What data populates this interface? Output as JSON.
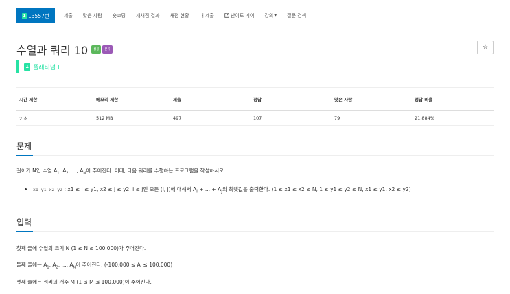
{
  "nav": {
    "problem_number": "13557번",
    "tier_glyph": "1",
    "items": [
      "제출",
      "맞은 사람",
      "숏코딩",
      "재채점 결과",
      "채점 현황",
      "내 제출"
    ],
    "difficulty": "난이도 기여",
    "lecture": "강의",
    "search": "질문 검색"
  },
  "title": "수열과 쿼리 10",
  "labels": {
    "success": "성공",
    "category": "분류"
  },
  "star_icon": "☆",
  "tier": {
    "glyph": "1",
    "text": "플래티넘 I"
  },
  "table": {
    "headers": [
      "시간 제한",
      "메모리 제한",
      "제출",
      "정답",
      "맞은 사람",
      "정답 비율"
    ],
    "row": [
      "2 초",
      "512 MB",
      "497",
      "107",
      "79",
      "21.884%"
    ]
  },
  "sections": {
    "problem": "문제",
    "input": "입력"
  },
  "problem": {
    "intro_a": "길이가 N인 수열 A",
    "intro_sub1": "1",
    "intro_b": ", A",
    "intro_sub2": "2",
    "intro_c": ", ..., A",
    "intro_subN": "N",
    "intro_d": "이 주어진다. 이때, 다음 쿼리를 수행하는 프로그램을 작성하시오.",
    "query_code": "x1 y1 x2 y2",
    "query_a": ": x1 ≤ i ≤ y1, x2 ≤ j ≤ y2, i ≤ j인 모든 (i, j)에 대해서 A",
    "query_sub_i": "i",
    "query_b": " + ... + A",
    "query_sub_j": "j",
    "query_c": "의 최댓값을 출력한다. (1 ≤ x1 ≤ x2 ≤ N, 1 ≤ y1 ≤ y2 ≤ N, x1 ≤ y1, x2 ≤ y2)"
  },
  "input": {
    "line1": "첫째 줄에 수열의 크기 N (1 ≤ N ≤ 100,000)가 주어진다.",
    "line2_a": "둘째 줄에는 A",
    "line2_sub1": "1",
    "line2_b": ", A",
    "line2_sub2": "2",
    "line2_c": ", ..., A",
    "line2_subN": "N",
    "line2_d": "이 주어진다. (-100,000 ≤ A",
    "line2_sub_i": "i",
    "line2_e": " ≤ 100,000)",
    "line3": "셋째 줄에는 쿼리의 개수 M (1 ≤ M ≤ 100,000)이 주어진다."
  },
  "colors": {
    "primary": "#0076c0",
    "platinum": "#27e2a4",
    "success": "#5cb85c",
    "category": "#9b59b6"
  }
}
